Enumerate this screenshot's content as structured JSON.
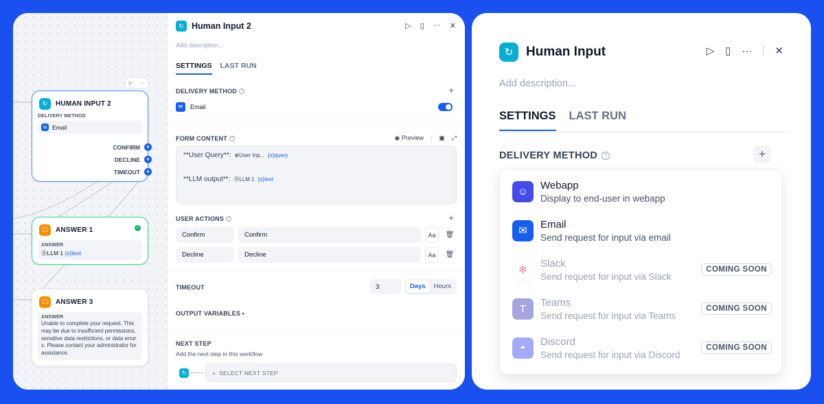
{
  "canvas": {
    "node_human": {
      "title": "HUMAN INPUT 2",
      "section": "DELIVERY METHOD",
      "method": "Email",
      "outputs": [
        "CONFIRM",
        "DECLINE",
        "TIMEOUT"
      ]
    },
    "node_answer1": {
      "title": "ANSWER 1",
      "label": "ANSWER",
      "src": "LLM 1",
      "var": "{x}text"
    },
    "node_answer3": {
      "title": "ANSWER 3",
      "label": "ANSWER",
      "text": "Unable to complete your request. This may be due to insufficient permissions, sensitive data restrictions, or data errors. Please contact your administrator for assistance."
    }
  },
  "panel": {
    "title": "Human Input 2",
    "description_placeholder": "Add description...",
    "tabs": [
      "SETTINGS",
      "LAST RUN"
    ],
    "delivery": {
      "label": "DELIVERY METHOD",
      "item": "Email",
      "enabled": true
    },
    "form_content": {
      "label": "FORM CONTENT",
      "preview": "Preview",
      "line1_label": "**User Query**:",
      "line1_src": "User Inp...",
      "line1_var": "{x}query",
      "line2_label": "**LLM output**:",
      "line2_src": "LLM 1",
      "line2_var": "{x}text"
    },
    "user_actions": {
      "label": "USER ACTIONS",
      "rows": [
        {
          "id": "Confirm",
          "text": "Confirm"
        },
        {
          "id": "Decline",
          "text": "Decline"
        }
      ]
    },
    "timeout": {
      "label": "TIMEOUT",
      "value": "3",
      "units": [
        "Days",
        "Hours"
      ],
      "selected": "Days"
    },
    "output_variables": "OUTPUT VARIABLES",
    "next_step": {
      "label": "NEXT STEP",
      "sub": "Add the next step in this workflow",
      "select": "SELECT NEXT STEP"
    }
  },
  "detail": {
    "title": "Human Input",
    "description_placeholder": "Add description...",
    "tabs": [
      "SETTINGS",
      "LAST RUN"
    ],
    "section": "DELIVERY METHOD",
    "options": [
      {
        "name": "Webapp",
        "desc": "Display to end-user in webapp",
        "icon": "robot-icon",
        "color": "#444ce7",
        "disabled": false,
        "badge": ""
      },
      {
        "name": "Email",
        "desc": "Send request for input via email",
        "icon": "mail-icon",
        "color": "#155eef",
        "disabled": false,
        "badge": ""
      },
      {
        "name": "Slack",
        "desc": "Send request for input via Slack",
        "icon": "slack-icon",
        "color": "#ffffff",
        "disabled": true,
        "badge": "COMING SOON"
      },
      {
        "name": "Teams",
        "desc": "Send request for input via Teams",
        "icon": "teams-icon",
        "color": "#5b5fc7",
        "disabled": true,
        "badge": "COMING SOON"
      },
      {
        "name": "Discord",
        "desc": "Send request for input via Discord",
        "icon": "discord-icon",
        "color": "#5865f2",
        "disabled": true,
        "badge": "COMING SOON"
      }
    ]
  }
}
